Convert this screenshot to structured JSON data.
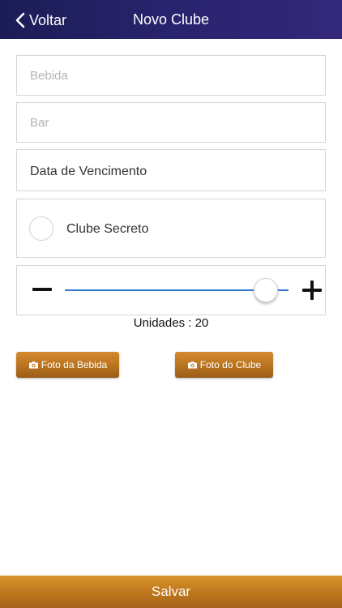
{
  "header": {
    "back_label": "Voltar",
    "title": "Novo Clube"
  },
  "form": {
    "bebida_placeholder": "Bebida",
    "bebida_value": "",
    "bar_placeholder": "Bar",
    "bar_value": "",
    "data_label": "Data de Vencimento",
    "secreto_label": "Clube Secreto",
    "secreto_checked": false
  },
  "units": {
    "label": "Unidades : 20",
    "value": 20,
    "slider_fraction": 0.9
  },
  "buttons": {
    "foto_bebida": "Foto da Bebida",
    "foto_clube": "Foto do Clube",
    "salvar": "Salvar"
  },
  "colors": {
    "header_bg": "#2a2470",
    "accent_orange": "#c17a1e",
    "slider_track": "#2e7ad1"
  },
  "icons": [
    "chevron-left-icon",
    "minus-icon",
    "plus-icon",
    "camera-icon"
  ]
}
